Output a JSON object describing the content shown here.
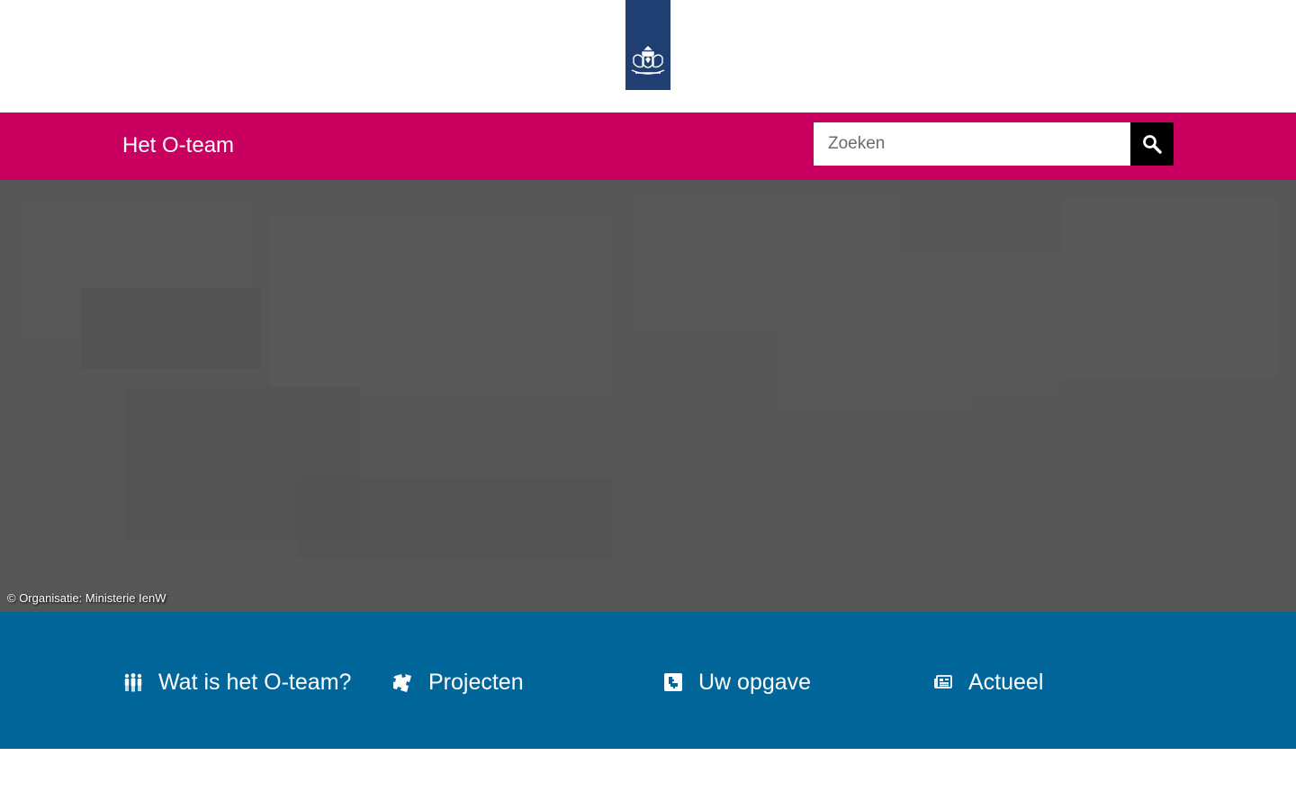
{
  "brand": {
    "logo_alt": "Rijksoverheid"
  },
  "header": {
    "site_title": "Het O-team",
    "search": {
      "placeholder": "Zoeken",
      "value": ""
    }
  },
  "hero": {
    "credit": "© Organisatie: Ministerie IenW"
  },
  "nav": {
    "items": [
      {
        "label": "Wat is het O-team?",
        "icon": "people-icon"
      },
      {
        "label": "Projecten",
        "icon": "puzzle-icon"
      },
      {
        "label": "Uw opgave",
        "icon": "puzzle-piece-icon"
      },
      {
        "label": "Actueel",
        "icon": "newspaper-icon"
      }
    ]
  },
  "colors": {
    "logo": "#1f3f73",
    "header": "#c9005f",
    "hero": "#565656",
    "nav": "#006699",
    "search_button": "#000000"
  }
}
